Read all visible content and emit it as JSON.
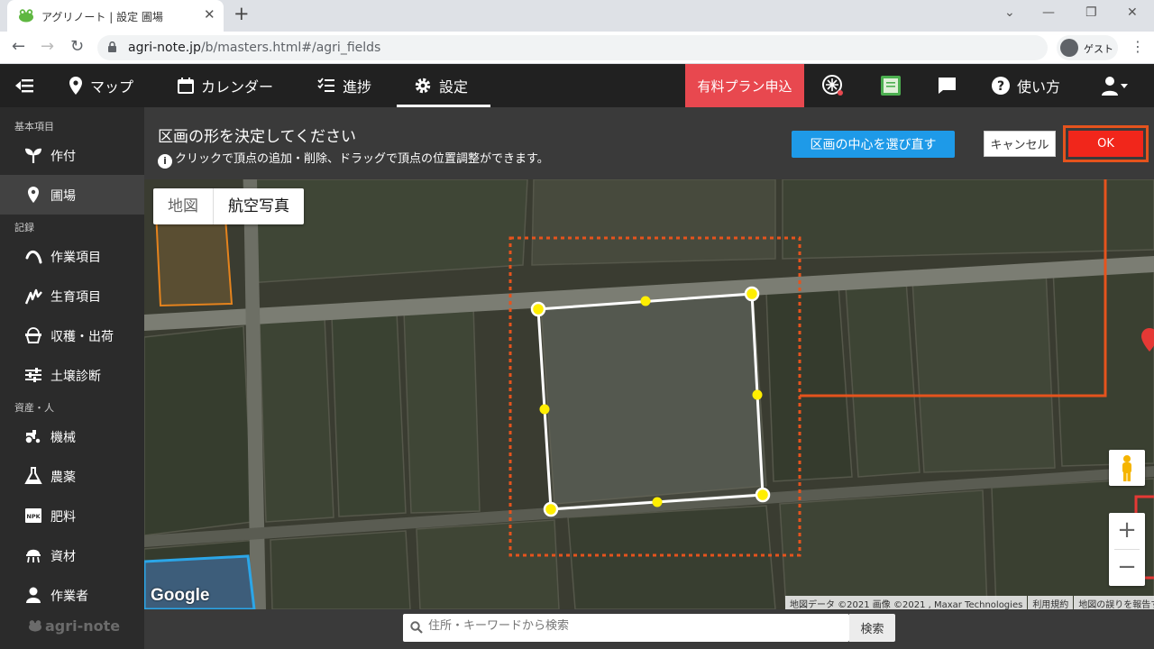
{
  "browser": {
    "tab_title": "アグリノート | 設定 圃場",
    "new_tab": "+",
    "url_host": "agri-note.jp",
    "url_path": "/b/masters.html#/agri_fields",
    "profile_label": "ゲスト"
  },
  "appnav": {
    "map": "マップ",
    "calendar": "カレンダー",
    "progress": "進捗",
    "settings": "設定",
    "paid_plan": "有料プラン申込",
    "help": "使い方"
  },
  "sidebar": {
    "section_basic": "基本項目",
    "crop": "作付",
    "field": "圃場",
    "section_record": "記録",
    "work_item": "作業項目",
    "growth_item": "生育項目",
    "harvest": "収穫・出荷",
    "soil": "土壌診断",
    "section_assets": "資産・人",
    "machine": "機械",
    "pesticide": "農薬",
    "fertilizer": "肥料",
    "material": "資材",
    "worker": "作業者",
    "logo": "agri-note"
  },
  "instruction": {
    "title": "区画の形を決定してください",
    "hint": "クリックで頂点の追加・削除、ドラッグで頂点の位置調整ができます。",
    "reselect_button": "区画の中心を選び直す",
    "cancel_button": "キャンセル",
    "ok_button": "OK"
  },
  "map": {
    "type_map": "地図",
    "type_aerial": "航空写真",
    "zoom_in": "+",
    "zoom_out": "−",
    "google_logo": "Google",
    "attribution": "地図データ ©2021 画像 ©2021 , Maxar Technologies",
    "terms": "利用規約",
    "report": "地図の誤りを報告する"
  },
  "search": {
    "placeholder": "住所・キーワードから検索",
    "button": "検索"
  },
  "colors": {
    "accent_red": "#f1261b",
    "annotation_orange": "#e5531d",
    "reselect_blue": "#1e9ae8",
    "paid_red": "#e8484f",
    "vertex_yellow": "#ffee00"
  }
}
